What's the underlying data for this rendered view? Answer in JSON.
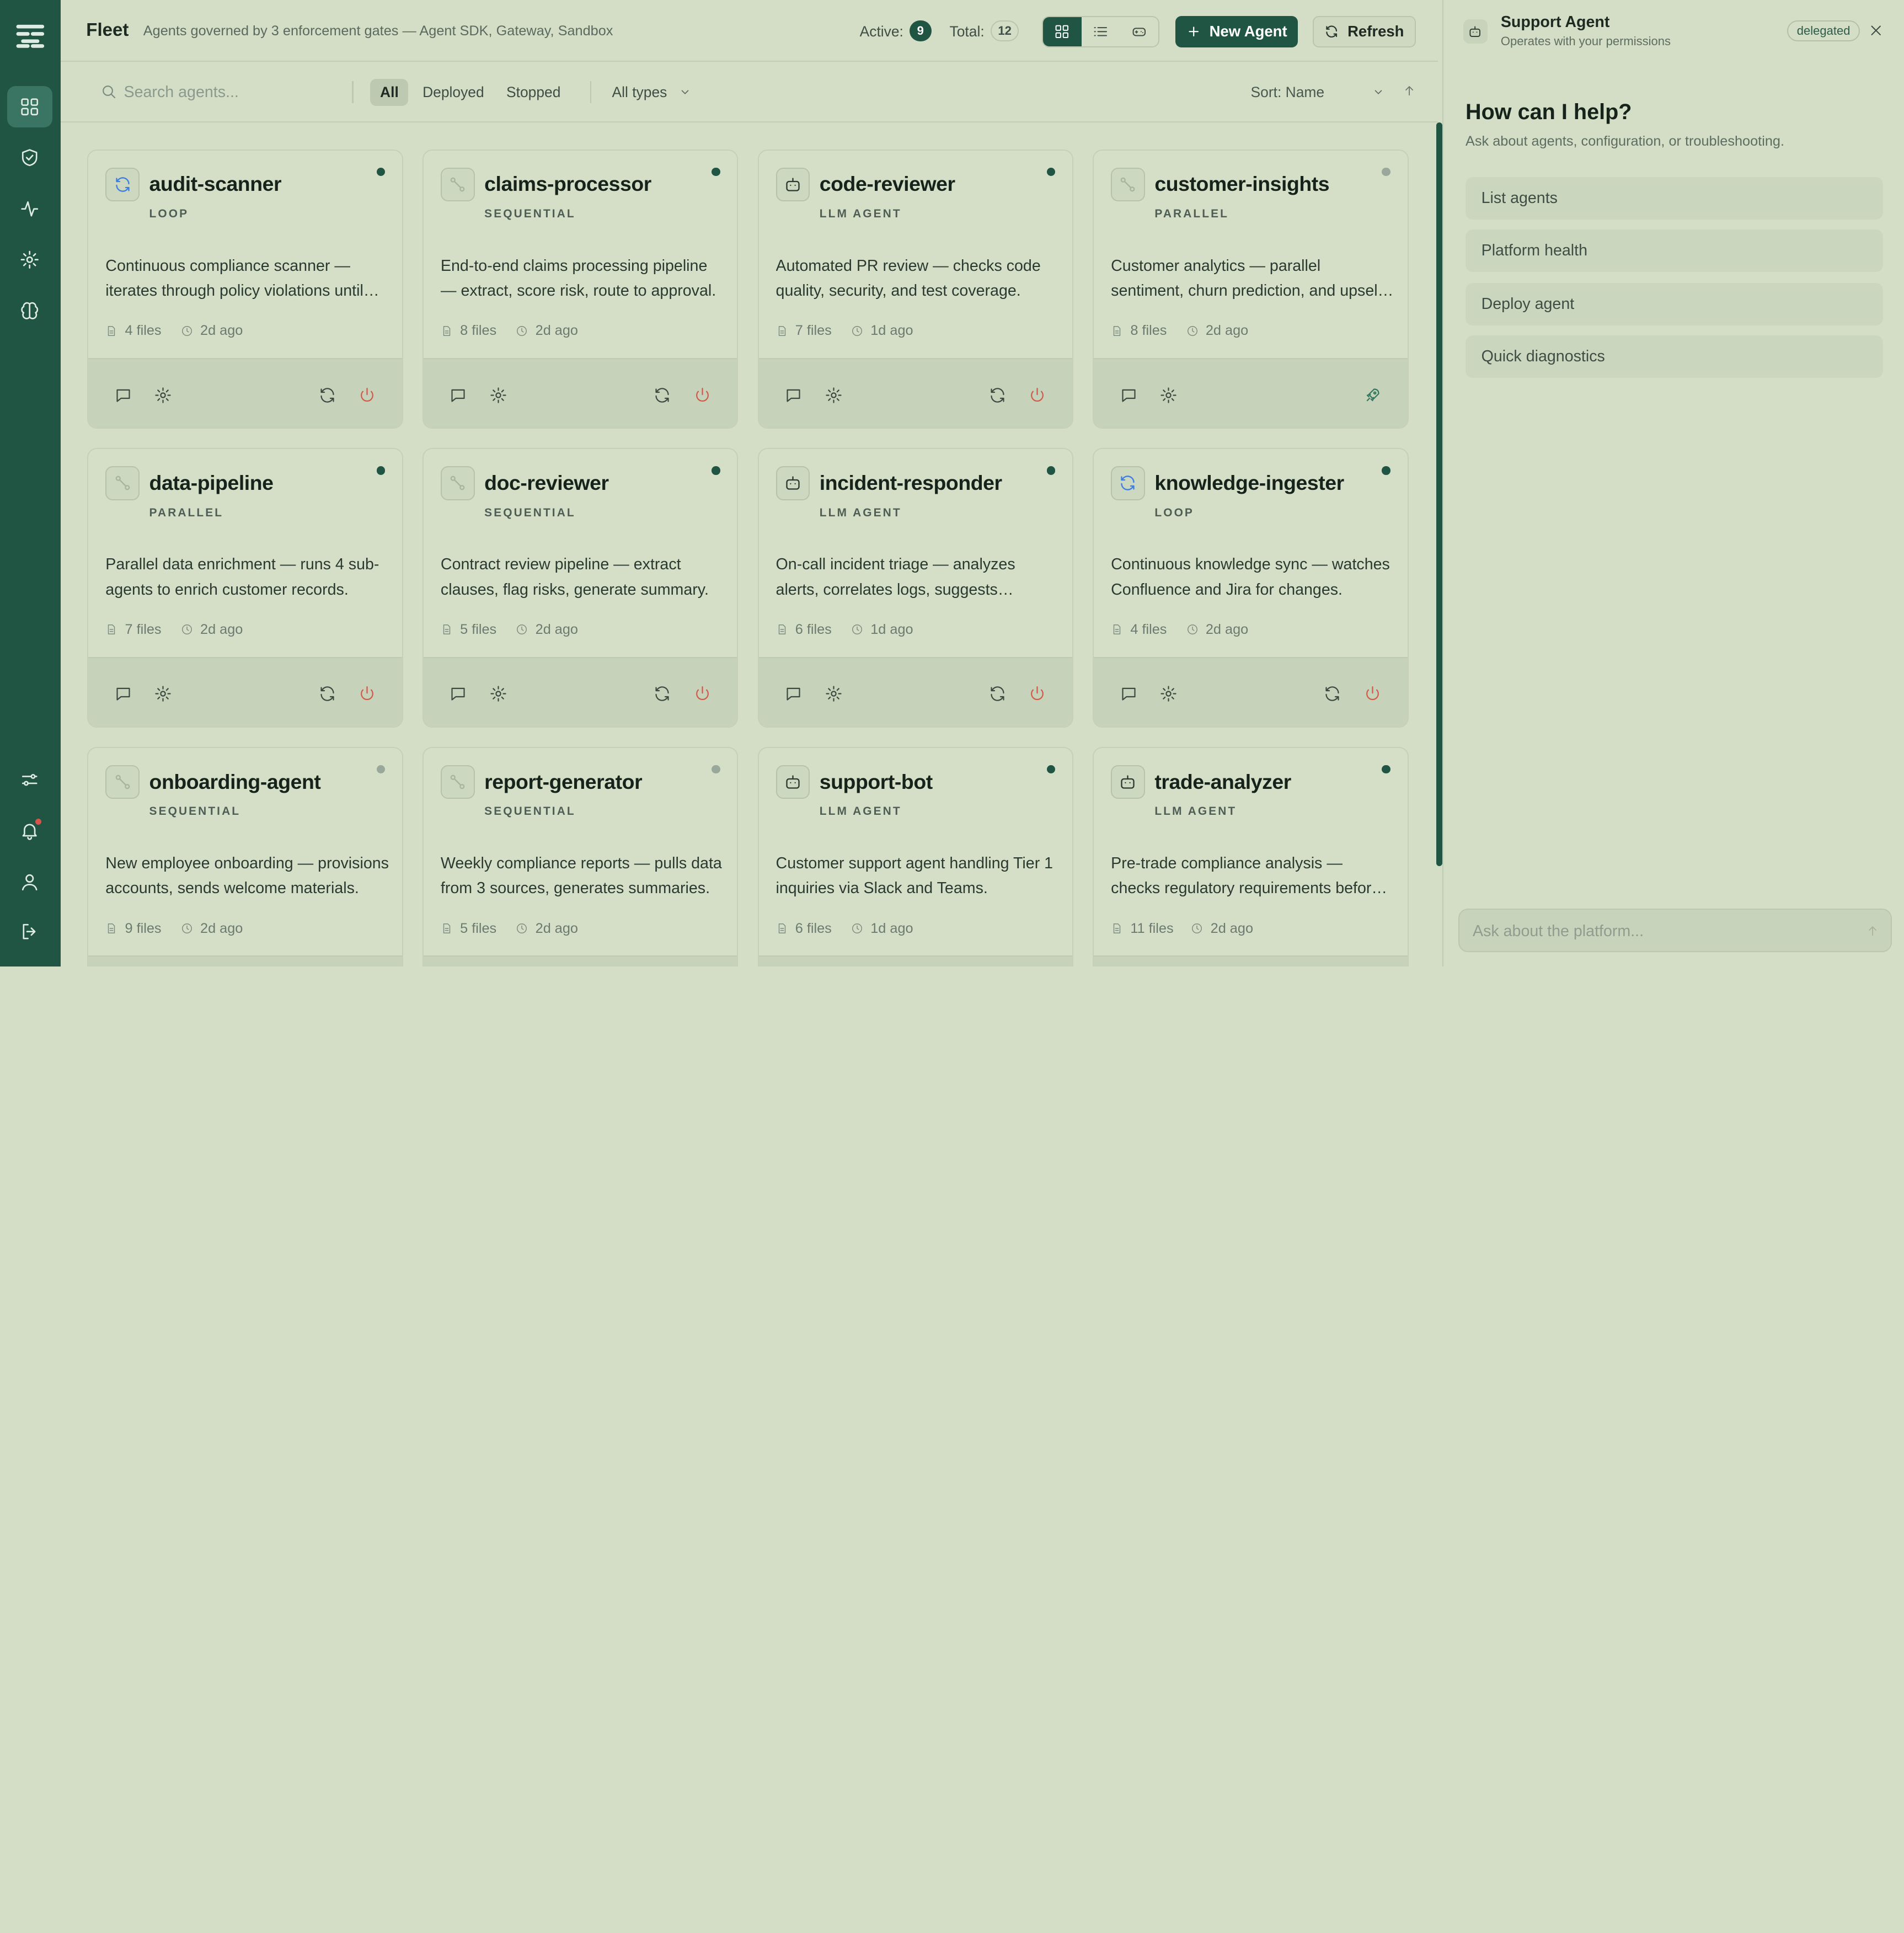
{
  "header": {
    "title": "Fleet",
    "subtitle": "Agents governed by 3 enforcement gates — Agent SDK, Gateway, Sandbox",
    "active_label": "Active:",
    "active_count": "9",
    "total_label": "Total:",
    "total_count": "12",
    "new_agent_label": "New Agent",
    "refresh_label": "Refresh"
  },
  "filters": {
    "search_placeholder": "Search agents...",
    "chips": [
      "All",
      "Deployed",
      "Stopped"
    ],
    "selected_chip": "All",
    "type_select": "All types",
    "sort_select": "Sort: Name"
  },
  "agents": [
    {
      "name": "audit-scanner",
      "type": "LOOP",
      "icon": "loop-icon",
      "status": "active",
      "desc": "Continuous compliance scanner — iterates through policy violations until resolved.",
      "files": "4 files",
      "updated": "2d ago",
      "action": "power"
    },
    {
      "name": "claims-processor",
      "type": "SEQUENTIAL",
      "icon": "sequential-icon",
      "status": "active",
      "desc": "End-to-end claims processing pipeline — extract, score risk, route to approval.",
      "files": "8 files",
      "updated": "2d ago",
      "action": "power"
    },
    {
      "name": "code-reviewer",
      "type": "LLM AGENT",
      "icon": "bot-icon",
      "status": "active",
      "desc": "Automated PR review — checks code quality, security, and test coverage.",
      "files": "7 files",
      "updated": "1d ago",
      "action": "power"
    },
    {
      "name": "customer-insights",
      "type": "PARALLEL",
      "icon": "sequential-icon",
      "status": "stopped",
      "desc": "Customer analytics — parallel sentiment, churn prediction, and upsell analysis.",
      "files": "8 files",
      "updated": "2d ago",
      "action": "deploy"
    },
    {
      "name": "data-pipeline",
      "type": "PARALLEL",
      "icon": "sequential-icon",
      "status": "active",
      "desc": "Parallel data enrichment — runs 4 sub-agents to enrich customer records.",
      "files": "7 files",
      "updated": "2d ago",
      "action": "power"
    },
    {
      "name": "doc-reviewer",
      "type": "SEQUENTIAL",
      "icon": "sequential-icon",
      "status": "active",
      "desc": "Contract review pipeline — extract clauses, flag risks, generate summary.",
      "files": "5 files",
      "updated": "2d ago",
      "action": "power"
    },
    {
      "name": "incident-responder",
      "type": "LLM AGENT",
      "icon": "bot-icon",
      "status": "active",
      "desc": "On-call incident triage — analyzes alerts, correlates logs, suggests remediation.",
      "files": "6 files",
      "updated": "1d ago",
      "action": "power"
    },
    {
      "name": "knowledge-ingester",
      "type": "LOOP",
      "icon": "loop-icon",
      "status": "active",
      "desc": "Continuous knowledge sync — watches Confluence and Jira for changes.",
      "files": "4 files",
      "updated": "2d ago",
      "action": "power"
    },
    {
      "name": "onboarding-agent",
      "type": "SEQUENTIAL",
      "icon": "sequential-icon",
      "status": "stopped",
      "desc": "New employee onboarding — provisions accounts, sends welcome materials.",
      "files": "9 files",
      "updated": "2d ago",
      "action": "power"
    },
    {
      "name": "report-generator",
      "type": "SEQUENTIAL",
      "icon": "sequential-icon",
      "status": "stopped",
      "desc": "Weekly compliance reports — pulls data from 3 sources, generates summaries.",
      "files": "5 files",
      "updated": "2d ago",
      "action": "power"
    },
    {
      "name": "support-bot",
      "type": "LLM AGENT",
      "icon": "bot-icon",
      "status": "active",
      "desc": "Customer support agent handling Tier 1 inquiries via Slack and Teams.",
      "files": "6 files",
      "updated": "1d ago",
      "action": "power"
    },
    {
      "name": "trade-analyzer",
      "type": "LLM AGENT",
      "icon": "bot-icon",
      "status": "active",
      "desc": "Pre-trade compliance analysis — checks regulatory requirements before execution.",
      "files": "11 files",
      "updated": "2d ago",
      "action": "power"
    }
  ],
  "panel": {
    "title": "Support Agent",
    "subtitle": "Operates with your permissions",
    "badge": "delegated",
    "help_title": "How can I help?",
    "help_subtitle": "Ask about agents, configuration, or troubleshooting.",
    "suggestions": [
      "List agents",
      "Platform health",
      "Deploy agent",
      "Quick diagnostics"
    ],
    "input_placeholder": "Ask about the platform..."
  },
  "colors": {
    "rail": "#205443",
    "accent": "#205443",
    "power": "#d05a47",
    "loop_icon": "#3f7de0"
  }
}
